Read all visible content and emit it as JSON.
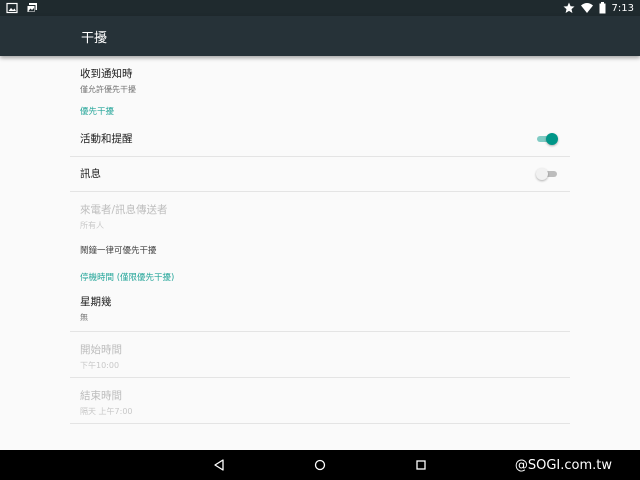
{
  "status_bar": {
    "time": "7:13",
    "left_icons": [
      "image-icon",
      "photo-stack-icon"
    ],
    "right_icons": [
      "star-icon",
      "wifi-icon",
      "battery-icon"
    ]
  },
  "app_bar": {
    "title": "干擾"
  },
  "settings": {
    "receive": {
      "title": "收到通知時",
      "summary": "僅允許優先干擾"
    },
    "priority_header": "優先干擾",
    "events": {
      "title": "活動和提醒",
      "enabled": true
    },
    "messages": {
      "title": "訊息",
      "enabled": false
    },
    "callers": {
      "title": "來電者/訊息傳送者",
      "summary": "所有人"
    },
    "alarms_note": "鬧鐘一律可優先干擾",
    "downtime_header": "停機時間 (僅限優先干擾)",
    "days": {
      "title": "星期幾",
      "summary": "無"
    },
    "start": {
      "title": "開始時間",
      "summary": "下午10:00"
    },
    "end": {
      "title": "結束時間",
      "summary": "隔天 上午7:00"
    }
  },
  "nav_bar": {
    "buttons": [
      "back-icon",
      "home-icon",
      "recents-icon"
    ]
  },
  "watermark": "@SOGI.com.tw",
  "colors": {
    "accent": "#009688",
    "app_bar": "#263238",
    "status_bar": "#1f2a2e"
  }
}
